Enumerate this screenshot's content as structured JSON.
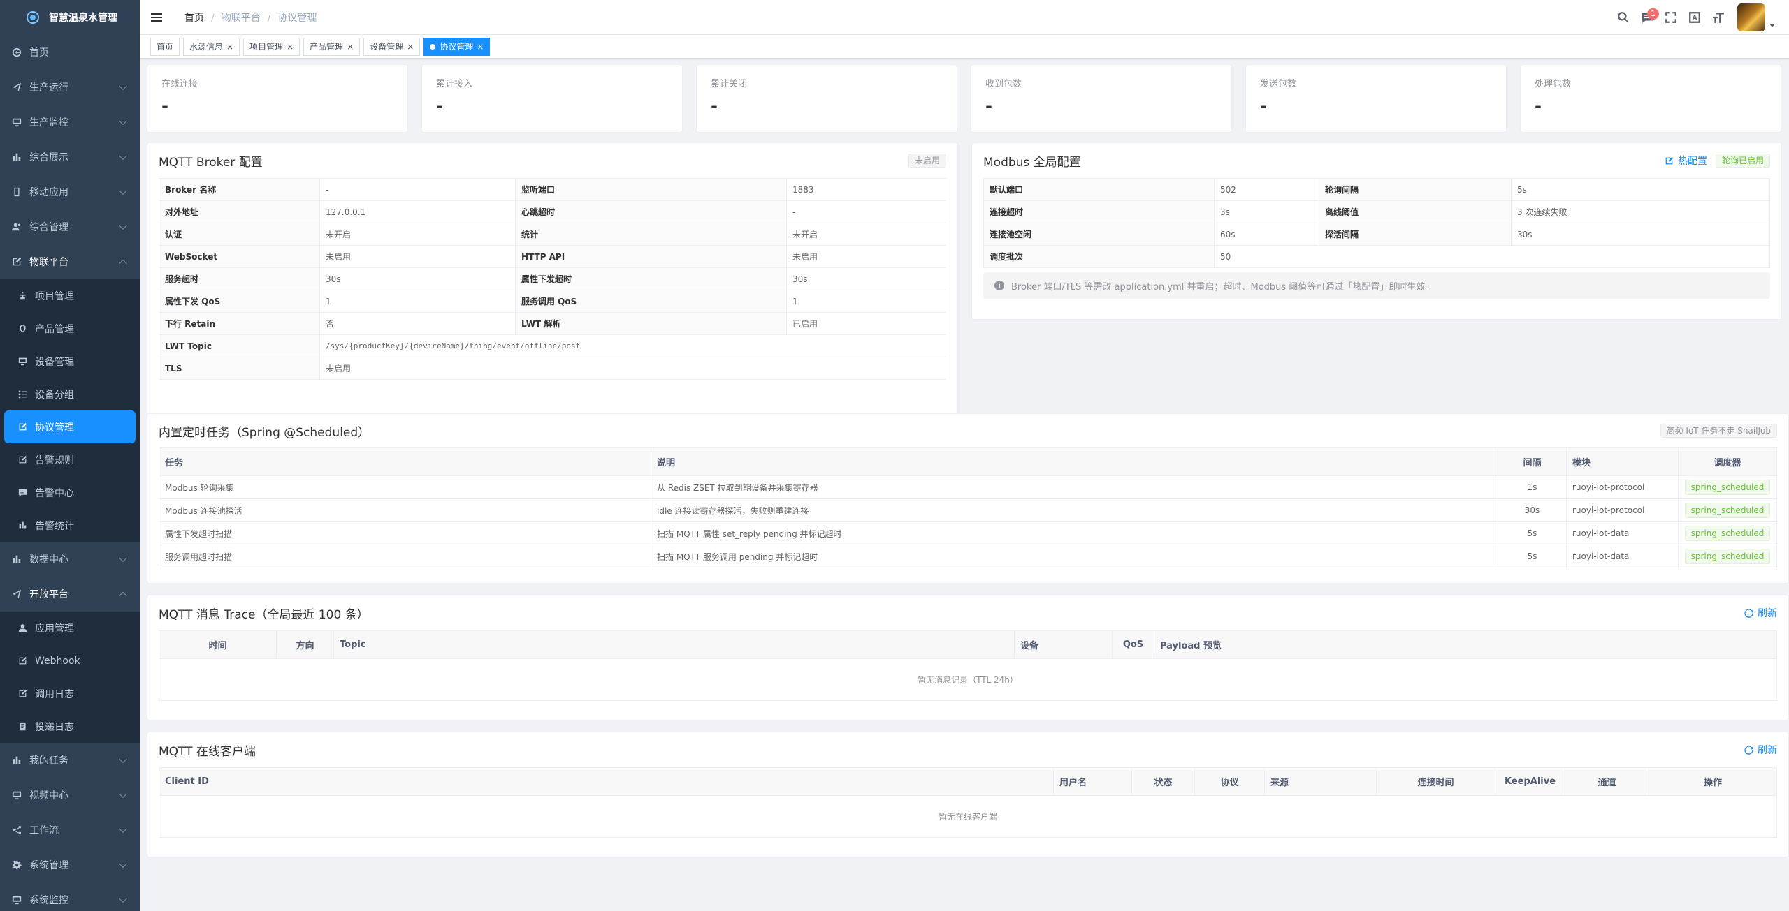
{
  "app": {
    "title": "智慧温泉水管理"
  },
  "sidebar": {
    "items": [
      {
        "label": "首页",
        "icon": "dashboard-icon"
      },
      {
        "label": "生产运行",
        "icon": "send-icon"
      },
      {
        "label": "生产监控",
        "icon": "monitor-icon"
      },
      {
        "label": "综合展示",
        "icon": "chart-icon"
      },
      {
        "label": "移动应用",
        "icon": "phone-icon"
      },
      {
        "label": "综合管理",
        "icon": "peoples-icon"
      },
      {
        "label": "物联平台",
        "icon": "edit-icon"
      }
    ],
    "iot_sub": [
      {
        "label": "项目管理",
        "icon": "tree-icon"
      },
      {
        "label": "产品管理",
        "icon": "product-icon"
      },
      {
        "label": "设备管理",
        "icon": "device-icon"
      },
      {
        "label": "设备分组",
        "icon": "list-icon"
      },
      {
        "label": "协议管理",
        "icon": "edit-icon"
      },
      {
        "label": "告警规则",
        "icon": "edit-icon"
      },
      {
        "label": "告警中心",
        "icon": "message-icon"
      },
      {
        "label": "告警统计",
        "icon": "chart-icon"
      }
    ],
    "data_center": {
      "label": "数据中心",
      "icon": "chart-icon"
    },
    "open_platform": {
      "label": "开放平台",
      "icon": "send-icon"
    },
    "open_sub": [
      {
        "label": "应用管理",
        "icon": "user-icon"
      },
      {
        "label": "Webhook",
        "icon": "edit-icon"
      },
      {
        "label": "调用日志",
        "icon": "form-icon"
      },
      {
        "label": "投递日志",
        "icon": "log-icon"
      }
    ],
    "tail": [
      {
        "label": "我的任务",
        "icon": "chart-icon"
      },
      {
        "label": "视频中心",
        "icon": "monitor-icon"
      },
      {
        "label": "工作流",
        "icon": "flow-icon"
      },
      {
        "label": "系统管理",
        "icon": "system-icon"
      },
      {
        "label": "系统监控",
        "icon": "monitor-icon"
      }
    ]
  },
  "navbar": {
    "breadcrumb": [
      "首页",
      "物联平台",
      "协议管理"
    ],
    "message_badge": "1"
  },
  "tags": [
    {
      "label": "首页",
      "closable": false
    },
    {
      "label": "水源信息",
      "closable": true
    },
    {
      "label": "项目管理",
      "closable": true
    },
    {
      "label": "产品管理",
      "closable": true
    },
    {
      "label": "设备管理",
      "closable": true
    },
    {
      "label": "协议管理",
      "closable": true,
      "active": true
    }
  ],
  "stats": [
    {
      "label": "在线连接",
      "value": "-"
    },
    {
      "label": "累计接入",
      "value": "-"
    },
    {
      "label": "累计关闭",
      "value": "-"
    },
    {
      "label": "收到包数",
      "value": "-"
    },
    {
      "label": "发送包数",
      "value": "-"
    },
    {
      "label": "处理包数",
      "value": "-"
    }
  ],
  "mqtt": {
    "title": "MQTT Broker 配置",
    "status": "未启用",
    "rows": [
      [
        "Broker 名称",
        "-",
        "监听端口",
        "1883"
      ],
      [
        "对外地址",
        "127.0.0.1",
        "心跳超时",
        "-"
      ],
      [
        "认证",
        "未开启",
        "统计",
        "未开启"
      ],
      [
        "WebSocket",
        "未启用",
        "HTTP API",
        "未启用"
      ],
      [
        "服务超时",
        "30s",
        "属性下发超时",
        "30s"
      ],
      [
        "属性下发 QoS",
        "1",
        "服务调用 QoS",
        "1"
      ],
      [
        "下行 Retain",
        "否",
        "LWT 解析",
        "已启用"
      ]
    ],
    "lwt_label": "LWT Topic",
    "lwt_value": "/sys/{productKey}/{deviceName}/thing/event/offline/post",
    "tls_label": "TLS",
    "tls_value": "未启用"
  },
  "modbus": {
    "title": "Modbus 全局配置",
    "hot_label": "热配置",
    "status": "轮询已启用",
    "rows": [
      [
        "默认端口",
        "502",
        "轮询间隔",
        "5s"
      ],
      [
        "连接超时",
        "3s",
        "离线阈值",
        "3 次连续失败"
      ],
      [
        "连接池空闲",
        "60s",
        "探活间隔",
        "30s"
      ]
    ],
    "batch_label": "调度批次",
    "batch_value": "50",
    "notice": "Broker 端口/TLS 等需改 application.yml 并重启；超时、Modbus 阈值等可通过「热配置」即时生效。"
  },
  "tasks": {
    "title": "内置定时任务（Spring @Scheduled）",
    "tag": "高频 IoT 任务不走 SnailJob",
    "headers": [
      "任务",
      "说明",
      "间隔",
      "模块",
      "调度器"
    ],
    "rows": [
      [
        "Modbus 轮询采集",
        "从 Redis ZSET 拉取到期设备并采集寄存器",
        "1s",
        "ruoyi-iot-protocol",
        "spring_scheduled"
      ],
      [
        "Modbus 连接池探活",
        "idle 连接读寄存器探活，失败则重建连接",
        "30s",
        "ruoyi-iot-protocol",
        "spring_scheduled"
      ],
      [
        "属性下发超时扫描",
        "扫描 MQTT 属性 set_reply pending 并标记超时",
        "5s",
        "ruoyi-iot-data",
        "spring_scheduled"
      ],
      [
        "服务调用超时扫描",
        "扫描 MQTT 服务调用 pending 并标记超时",
        "5s",
        "ruoyi-iot-data",
        "spring_scheduled"
      ]
    ]
  },
  "trace": {
    "title": "MQTT 消息 Trace（全局最近 100 条）",
    "refresh": "刷新",
    "headers": [
      "时间",
      "方向",
      "Topic",
      "设备",
      "QoS",
      "Payload 预览"
    ],
    "empty": "暂无消息记录（TTL 24h）"
  },
  "clients": {
    "title": "MQTT 在线客户端",
    "refresh": "刷新",
    "headers": [
      "Client ID",
      "用户名",
      "状态",
      "协议",
      "来源",
      "连接时间",
      "KeepAlive",
      "通道",
      "操作"
    ],
    "empty": "暂无在线客户端"
  }
}
